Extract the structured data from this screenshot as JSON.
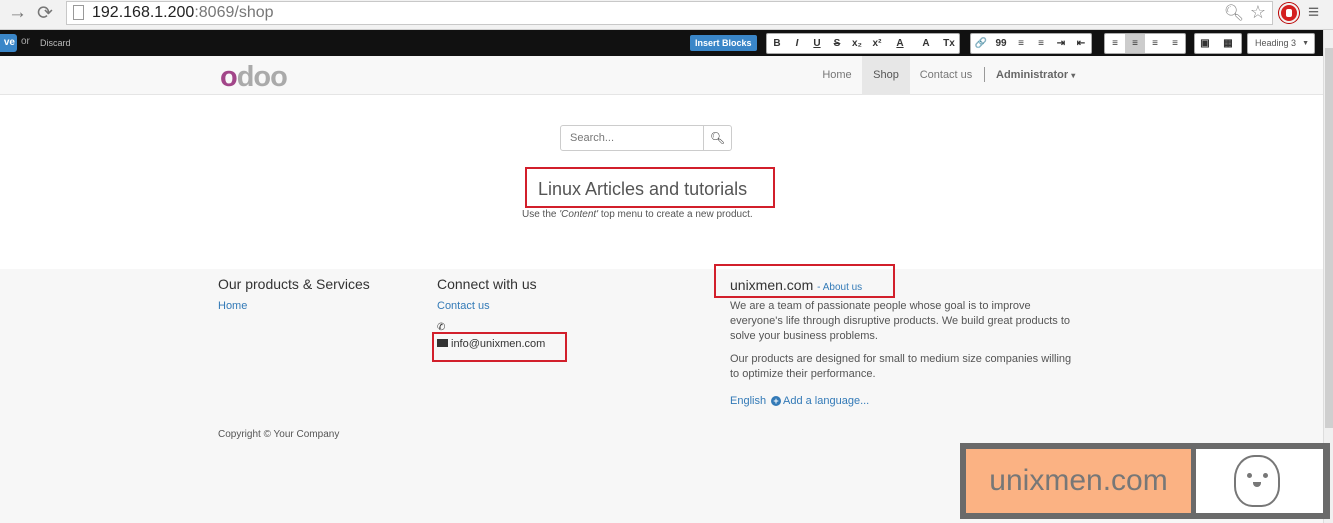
{
  "browser": {
    "url_host": "192.168.1.200",
    "url_rest": ":8069/shop"
  },
  "editor": {
    "save_label": "ve",
    "or_label": "or",
    "discard_label": "Discard",
    "insert_blocks_label": "Insert Blocks",
    "format_buttons": [
      "B",
      "I",
      "U",
      "S",
      "x₂",
      "x²",
      "A",
      "A",
      "Tx"
    ],
    "para_buttons": [
      "🔗",
      "99",
      "≡",
      "≡",
      "⇥",
      "⇤"
    ],
    "align_buttons": [
      "≡",
      "≡",
      "≡",
      "≡"
    ],
    "media_buttons": [
      "▣",
      "▦"
    ],
    "heading_select": "Heading 3"
  },
  "header": {
    "logo": "odoo",
    "nav": [
      "Home",
      "Shop",
      "Contact us"
    ],
    "active_nav": "Shop",
    "user": "Administrator"
  },
  "main": {
    "search_placeholder": "Search...",
    "title": "Linux Articles and tutorials",
    "hint_prefix": "Use the ",
    "hint_em": "'Content'",
    "hint_suffix": " top menu to create a new product."
  },
  "footer": {
    "products_title": "Our products & Services",
    "products_link": "Home",
    "connect_title": "Connect with us",
    "connect_link": "Contact us",
    "email": "info@unixmen.com",
    "about_title": "unixmen.com",
    "about_link": "- About us",
    "about_p1": "We are a team of passionate people whose goal is to improve everyone's life through disruptive products. We build great products to solve your business problems.",
    "about_p2": "Our products are designed for small to medium size companies willing to optimize their performance.",
    "lang_current": "English",
    "lang_add": "Add a language...",
    "copyright": "Copyright © Your Company"
  },
  "watermark": {
    "text": "unixmen.com"
  },
  "colors": {
    "accent": "#337ab7",
    "highlight_box": "#d21f2b",
    "logo_purple": "#a24689"
  }
}
